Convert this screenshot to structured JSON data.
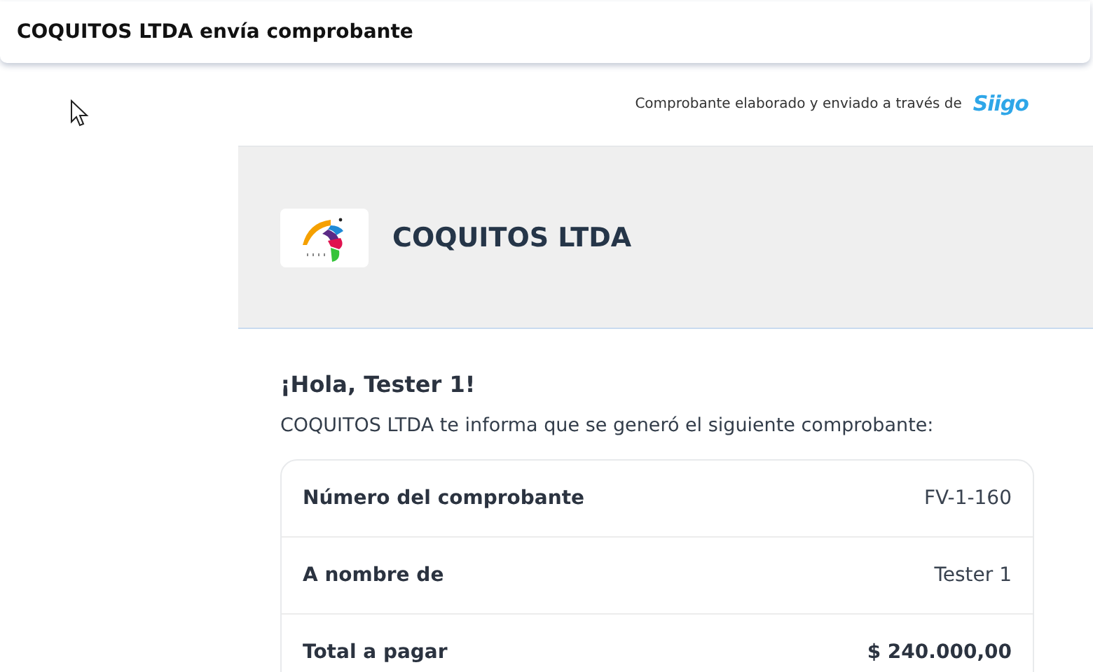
{
  "window": {
    "title": "COQUITOS LTDA envía comprobante"
  },
  "attribution": {
    "text": "Comprobante elaborado y enviado a través de",
    "brand": "Siigo"
  },
  "company": {
    "name": "COQUITOS LTDA"
  },
  "greeting": "¡Hola, Tester 1!",
  "message": "COQUITOS LTDA te informa que se generó el siguiente comprobante:",
  "details": [
    {
      "label": "Número del comprobante",
      "value": "FV-1-160",
      "emphasis": false
    },
    {
      "label": "A nombre de",
      "value": "Tester 1",
      "emphasis": false
    },
    {
      "label": "Total a pagar",
      "value": "$ 240.000,00",
      "emphasis": true
    }
  ]
}
